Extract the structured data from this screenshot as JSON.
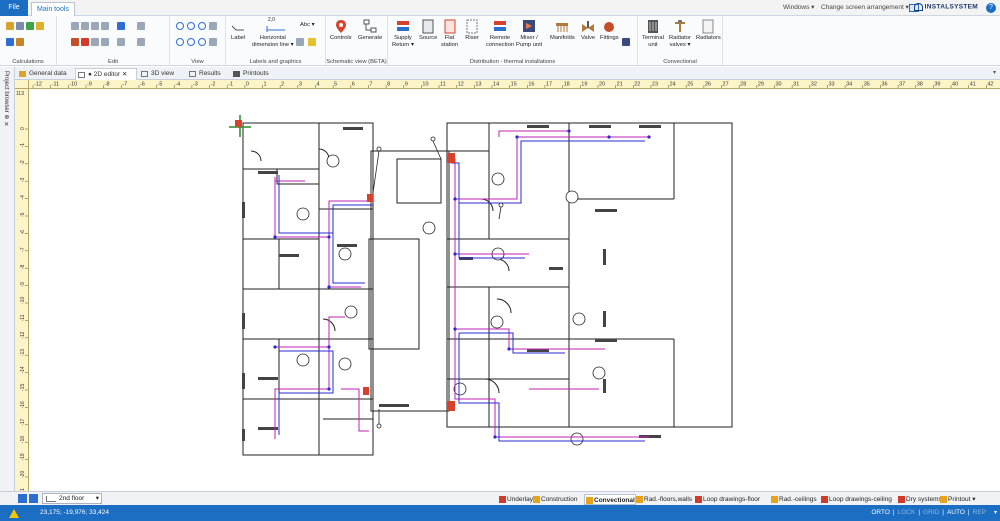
{
  "app": {
    "file_tab": "File",
    "main_tab": "Main tools",
    "windows_menu": "Windows ▾",
    "arrangement_menu": "Change screen arrangement ▾",
    "brand": "INSTALSYSTEM",
    "help": "?"
  },
  "ribbon": {
    "groups": [
      {
        "label": "Calculations"
      },
      {
        "label": "Edit"
      },
      {
        "label": "View"
      },
      {
        "label": "Labels and graphics"
      },
      {
        "label": "Schematic view  (BETA)"
      },
      {
        "label": "Distribution - thermal installations"
      },
      {
        "label": "Convectional"
      }
    ],
    "buttons": {
      "label": "Label",
      "horizontal_dim": "Horizontal\ndimension line ▾",
      "dim_value": "2,0",
      "abc": "Abc ▾",
      "controls": "Controls",
      "generate": "Generate",
      "supply_return": "Supply\nReturn ▾",
      "source": "Source",
      "flat_station": "Flat\nstation",
      "riser": "Riser",
      "remote_connection": "Remote\nconnection",
      "mixer_pump": "Mixer /\nPump unit",
      "manifolds": "Manifolds",
      "valve": "Valve",
      "fittings": "Fittings",
      "terminal_unit": "Terminal\nunit",
      "radiator_valves": "Radiator\nvalves ▾",
      "radiators": "Radiators"
    }
  },
  "doc_tabs": [
    {
      "label": "General data"
    },
    {
      "label": "● 2D editor ✕"
    },
    {
      "label": "3D view"
    },
    {
      "label": "Results"
    },
    {
      "label": "Printouts"
    }
  ],
  "left_strip": {
    "label": "Project browser ⊕ ✕"
  },
  "ruler": {
    "h_ticks": [
      "-12",
      "-11",
      "-10",
      "-9",
      "-8",
      "-7",
      "-6",
      "-5",
      "-4",
      "-3",
      "-2",
      "-1",
      "0",
      "1",
      "2",
      "3",
      "4",
      "5",
      "6",
      "7",
      "8",
      "9",
      "10",
      "11",
      "12",
      "13",
      "14",
      "15",
      "16",
      "17",
      "18",
      "19",
      "20",
      "21",
      "22",
      "23",
      "24",
      "25",
      "26",
      "27",
      "28",
      "29",
      "30",
      "31",
      "32",
      "33",
      "34",
      "35",
      "36",
      "37",
      "38",
      "39",
      "40",
      "41",
      "42"
    ],
    "v_ticks": [
      "0",
      "-1",
      "-2",
      "-3",
      "-4",
      "-5",
      "-6",
      "-7",
      "-8",
      "-9",
      "-10",
      "-11",
      "-12",
      "-13",
      "-14",
      "-15",
      "-16",
      "-17",
      "-18",
      "-19",
      "-20",
      "-21",
      "-22"
    ],
    "v_top": "113"
  },
  "floor": {
    "selected": "2nd floor"
  },
  "layers": [
    {
      "label": "Underlay",
      "color": "#d23b2c"
    },
    {
      "label": "Construction",
      "color": "#e8a21c"
    },
    {
      "label": "Convectional",
      "color": "#e8a21c"
    },
    {
      "label": "Rad.-floors,walls",
      "color": "#e8a21c"
    },
    {
      "label": "Loop drawings-floor",
      "color": "#d23b2c"
    },
    {
      "label": "Rad.-ceilings",
      "color": "#e8a21c"
    },
    {
      "label": "Loop drawings-ceiling",
      "color": "#d23b2c"
    },
    {
      "label": "Dry systems",
      "color": "#d23b2c"
    },
    {
      "label": "Printout ▾",
      "color": "#e8a21c"
    }
  ],
  "status": {
    "coords": "23,175; -19,976; 33,424",
    "modes": [
      {
        "label": "ORTO",
        "on": true
      },
      {
        "label": "|",
        "on": true
      },
      {
        "label": "LOCK",
        "on": false
      },
      {
        "label": "|",
        "on": true
      },
      {
        "label": "GRID",
        "on": false
      },
      {
        "label": "|",
        "on": true
      },
      {
        "label": "AUTO",
        "on": true
      },
      {
        "label": "|",
        "on": true
      },
      {
        "label": "REP",
        "on": false
      }
    ]
  },
  "colors": {
    "accent": "#1b6ec2",
    "ruler": "#fdf5c8",
    "pipe_supply": "#c01fb0",
    "pipe_return": "#2a2ad0"
  }
}
